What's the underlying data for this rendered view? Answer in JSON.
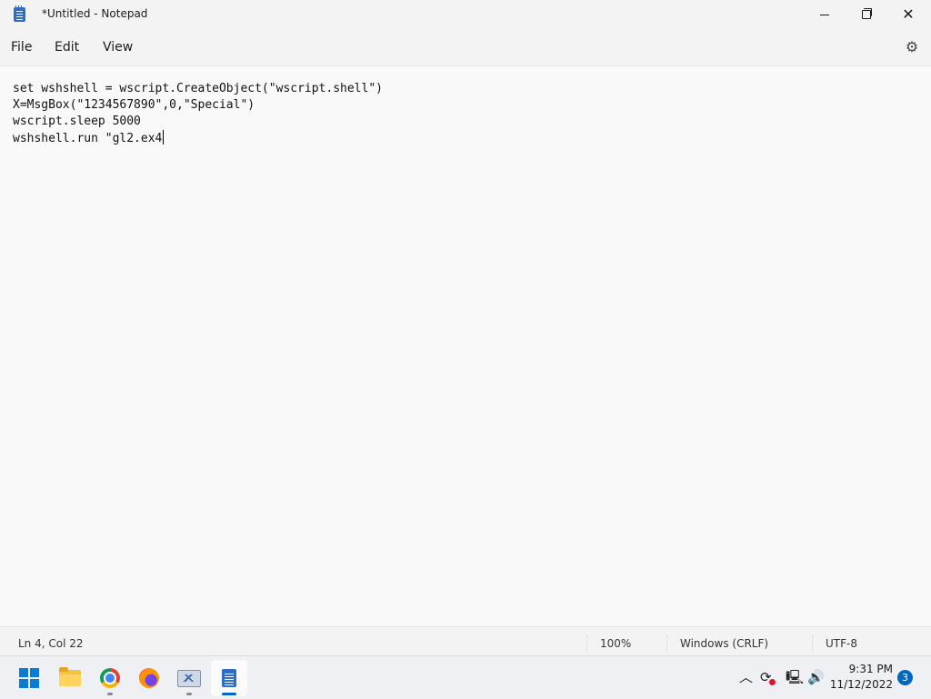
{
  "window": {
    "title": "*Untitled - Notepad",
    "app_icon": "notepad-icon",
    "controls": {
      "minimize": "minimize-icon",
      "maximize": "restore-icon",
      "close": "close-icon"
    }
  },
  "menu": {
    "file": "File",
    "edit": "Edit",
    "view": "View",
    "settings_icon": "gear-icon"
  },
  "editor": {
    "lines": [
      "set wshshell = wscript.CreateObject(\"wscript.shell\")",
      "X=MsgBox(\"1234567890\",0,\"Special\")",
      "wscript.sleep 5000",
      "wshshell.run \"gl2.ex4"
    ]
  },
  "status": {
    "position": "Ln 4, Col 22",
    "zoom": "100%",
    "line_ending": "Windows (CRLF)",
    "encoding": "UTF-8"
  },
  "taskbar": {
    "apps": [
      "start-icon",
      "file-explorer-icon",
      "chrome-icon",
      "firefox-icon",
      "resource-monitor-icon",
      "notepad-icon"
    ],
    "active_app": "notepad-icon",
    "tray": {
      "time": "9:31 PM",
      "date": "11/12/2022",
      "notifications": "3"
    }
  },
  "colors": {
    "accent": "#0067c0",
    "window_bg": "#f9f9f9",
    "chrome_bg": "#f3f3f3"
  }
}
